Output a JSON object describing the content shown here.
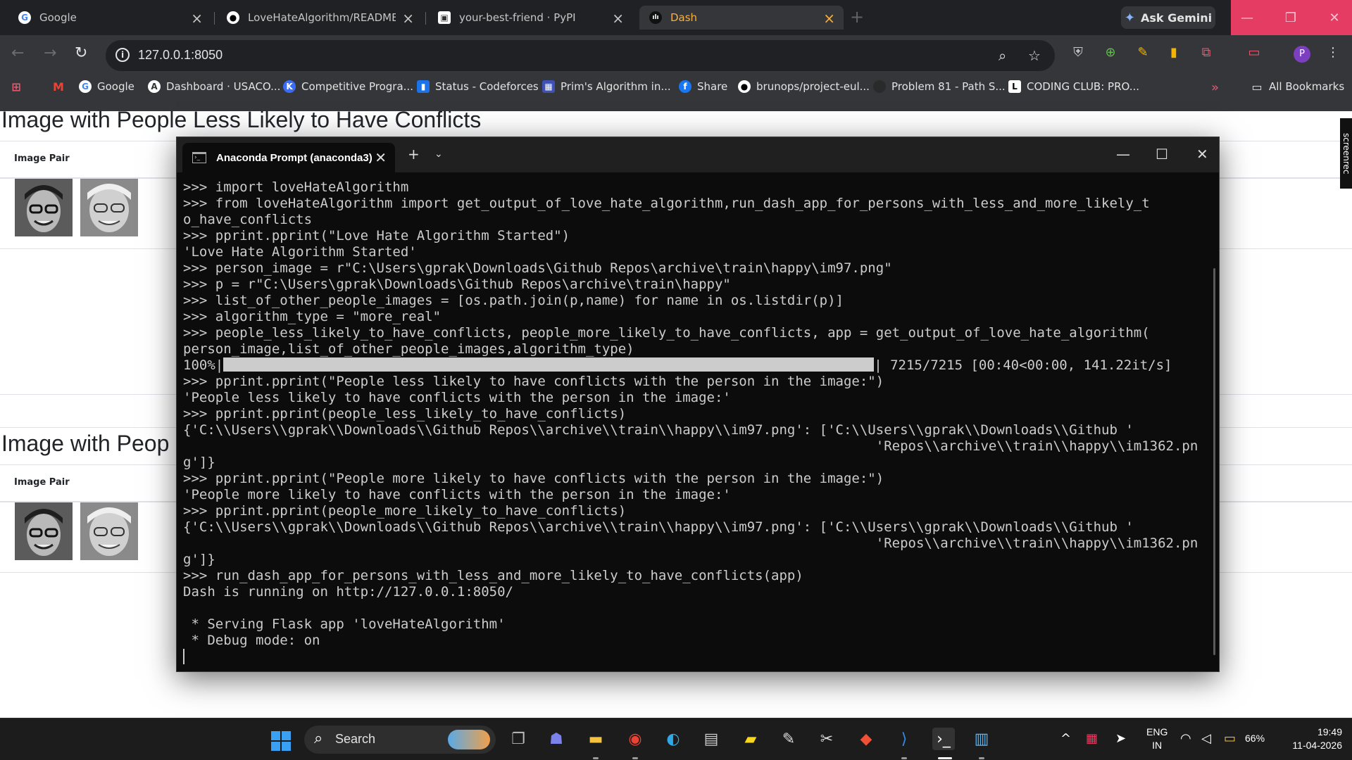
{
  "browser": {
    "tabs": [
      {
        "title": "Google",
        "favicon": "G"
      },
      {
        "title": "LoveHateAlgorithm/README.md",
        "favicon": "gh"
      },
      {
        "title": "your-best-friend · PyPI",
        "favicon": "box"
      },
      {
        "title": "Dash",
        "favicon": "dash",
        "active": true
      }
    ],
    "ask_gemini": "Ask Gemini",
    "url": "127.0.0.1:8050",
    "bookmarks": [
      {
        "label": "Google"
      },
      {
        "label": "Dashboard · USACO..."
      },
      {
        "label": "Competitive Progra..."
      },
      {
        "label": "Status - Codeforces"
      },
      {
        "label": "Prim's Algorithm in..."
      },
      {
        "label": "Share"
      },
      {
        "label": "brunops/project-eul..."
      },
      {
        "label": "Problem 81 - Path S..."
      },
      {
        "label": "CODING CLUB: PRO..."
      }
    ],
    "all_bookmarks": "All Bookmarks",
    "profile_initial": "P"
  },
  "page": {
    "section1_title": "Image with People Less Likely to Have Conflicts",
    "section2_title": "Image with Peop",
    "col_header": "Image Pair",
    "screenrec_label": "screenrec"
  },
  "terminal": {
    "tab_title": "Anaconda Prompt (anaconda3)",
    "lines": [
      ">>> import loveHateAlgorithm",
      ">>> from loveHateAlgorithm import get_output_of_love_hate_algorithm,run_dash_app_for_persons_with_less_and_more_likely_t",
      "o_have_conflicts",
      ">>> pprint.pprint(\"Love Hate Algorithm Started\")",
      "'Love Hate Algorithm Started'",
      ">>> person_image = r\"C:\\Users\\gprak\\Downloads\\Github Repos\\archive\\train\\happy\\im97.png\"",
      ">>> p = r\"C:\\Users\\gprak\\Downloads\\Github Repos\\archive\\train\\happy\"",
      ">>> list_of_other_people_images = [os.path.join(p,name) for name in os.listdir(p)]",
      ">>> algorithm_type = \"more_real\"",
      ">>> people_less_likely_to_have_conflicts, people_more_likely_to_have_conflicts, app = get_output_of_love_hate_algorithm(",
      "person_image,list_of_other_people_images,algorithm_type)"
    ],
    "progress_prefix": "100%|",
    "progress_suffix": "| 7215/7215 [00:40<00:00, 141.22it/s]",
    "progress_fraction": 1.0,
    "lines2": [
      ">>> pprint.pprint(\"People less likely to have conflicts with the person in the image:\")",
      "'People less likely to have conflicts with the person in the image:'",
      ">>> pprint.pprint(people_less_likely_to_have_conflicts)",
      "{'C:\\\\Users\\\\gprak\\\\Downloads\\\\Github Repos\\\\archive\\\\train\\\\happy\\\\im97.png': ['C:\\\\Users\\\\gprak\\\\Downloads\\\\Github '",
      "                                                                                      'Repos\\\\archive\\\\train\\\\happy\\\\im1362.pn",
      "g']}",
      ">>> pprint.pprint(\"People more likely to have conflicts with the person in the image:\")",
      "'People more likely to have conflicts with the person in the image:'",
      ">>> pprint.pprint(people_more_likely_to_have_conflicts)",
      "{'C:\\\\Users\\\\gprak\\\\Downloads\\\\Github Repos\\\\archive\\\\train\\\\happy\\\\im97.png': ['C:\\\\Users\\\\gprak\\\\Downloads\\\\Github '",
      "                                                                                      'Repos\\\\archive\\\\train\\\\happy\\\\im1362.pn",
      "g']}",
      ">>> run_dash_app_for_persons_with_less_and_more_likely_to_have_conflicts(app)",
      "Dash is running on http://127.0.0.1:8050/",
      "",
      " * Serving Flask app 'loveHateAlgorithm'",
      " * Debug mode: on"
    ]
  },
  "taskbar": {
    "search_label": "Search",
    "lang_line1": "ENG",
    "lang_line2": "IN",
    "battery": "66%",
    "time": "19:49",
    "date": "11-04-2026"
  },
  "colors": {
    "accent_tab": "#f8b040",
    "window_controls": "#e43c63",
    "chrome_dark": "#202124",
    "terminal_bg": "#0c0c0c",
    "taskbar": "#1c1c1c"
  }
}
